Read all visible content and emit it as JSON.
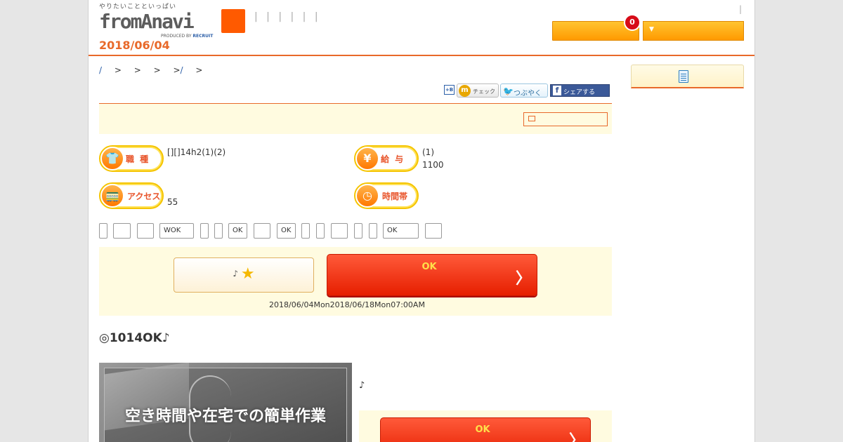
{
  "header": {
    "tagline": "やりたいことといっぱい",
    "logo": "fromAnavi",
    "produced_by": "PRODUCED BY",
    "produced_brand": "RECRUIT",
    "date": "2018/06/04",
    "nav_pipes": "| | | | | |",
    "top_pipe": "|",
    "fav_count": "0",
    "menu_arrow": "▼"
  },
  "breadcrumb": {
    "first": "/",
    "middle": "> > > >",
    "slash": "/",
    "last": ">"
  },
  "share": {
    "hatena": "+B",
    "mixi_letter": "m",
    "mixi_label": "チェック",
    "twitter_label": "つぶやく",
    "facebook_letter": "f",
    "facebook_label": "シェアする"
  },
  "info": {
    "job_type_label": "職 種",
    "job_type_text": "[][]14h2(1)(2)",
    "salary_label": "給 与",
    "salary_symbol": "¥",
    "salary_line1": "(1)",
    "salary_line2": "1100",
    "access_label": "アクセス",
    "access_text": "55",
    "hours_label": "時間帯"
  },
  "tags": [
    "",
    "",
    "",
    "WOK",
    "",
    "",
    "OK",
    "",
    "OK",
    "",
    "",
    "",
    "",
    "",
    "OK",
    ""
  ],
  "apply": {
    "keep_label": "♪",
    "keep_star": "★",
    "ok_label": "OK",
    "arrow": "〉",
    "deadline": "2018/06/04Mon2018/06/18Mon07:00AM"
  },
  "headline": "◎1014OK♪",
  "photo_caption": "空き時間や在宅での簡単作業",
  "note_mark": "♪",
  "apply2": {
    "ok_label": "OK",
    "arrow": "〉"
  }
}
